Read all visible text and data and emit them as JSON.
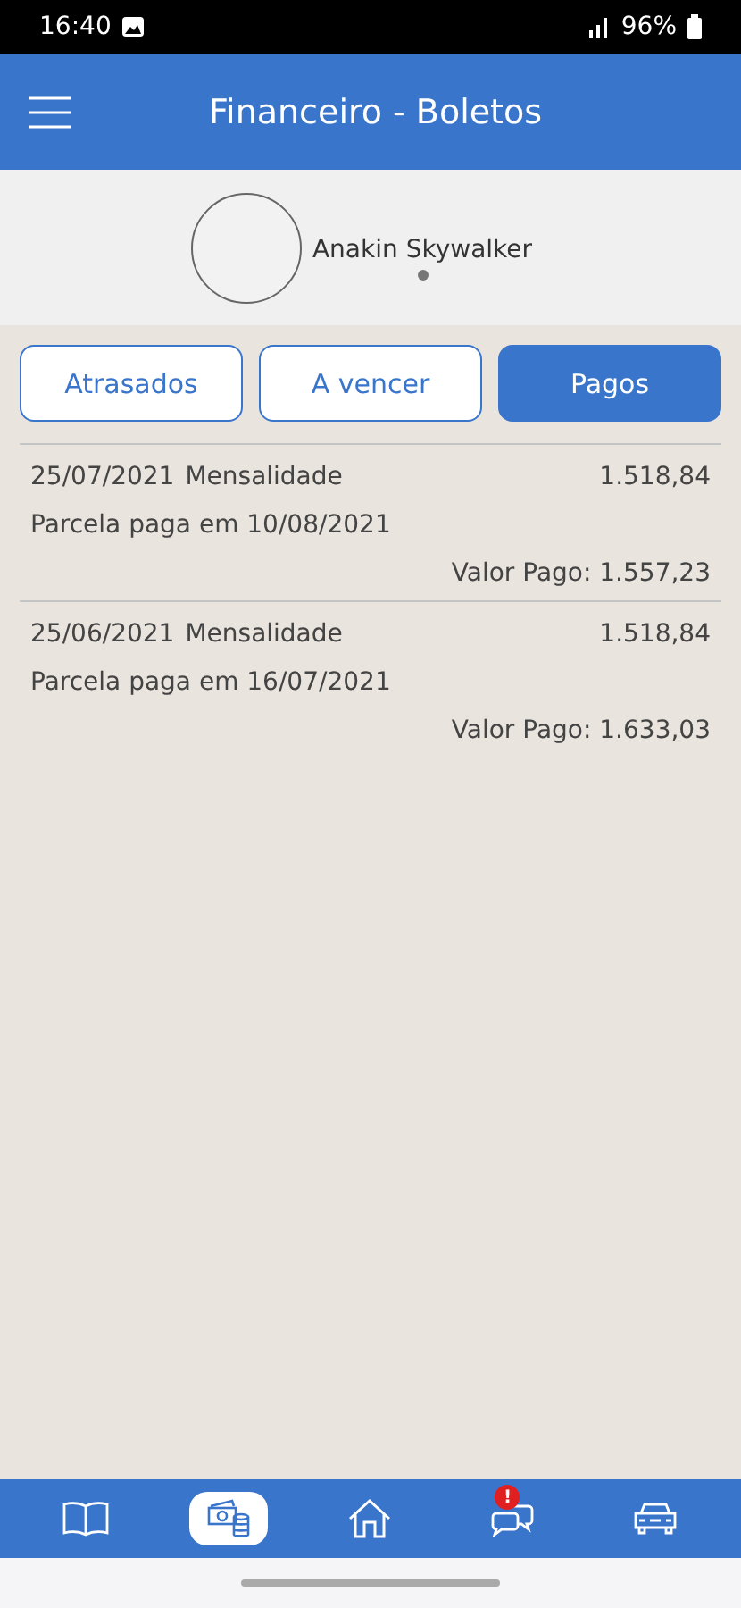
{
  "status_bar": {
    "time": "16:40",
    "battery": "96%"
  },
  "header": {
    "title": "Financeiro - Boletos"
  },
  "profile": {
    "name": "Anakin Skywalker"
  },
  "tabs": [
    {
      "label": "Atrasados",
      "selected": false
    },
    {
      "label": "A vencer",
      "selected": false
    },
    {
      "label": "Pagos",
      "selected": true
    }
  ],
  "boletos": [
    {
      "date": "25/07/2021",
      "description": "Mensalidade",
      "amount": "1.518,84",
      "paid_on": "Parcela paga em 10/08/2021",
      "paid_value": "Valor Pago: 1.557,23"
    },
    {
      "date": "25/06/2021",
      "description": "Mensalidade",
      "amount": "1.518,84",
      "paid_on": "Parcela paga em 16/07/2021",
      "paid_value": "Valor Pago: 1.633,03"
    }
  ],
  "bottom_nav": [
    {
      "kind": "book",
      "selected": false
    },
    {
      "kind": "money",
      "selected": true
    },
    {
      "kind": "home",
      "selected": false
    },
    {
      "kind": "chat",
      "selected": false,
      "badge": "!"
    },
    {
      "kind": "car",
      "selected": false
    }
  ]
}
